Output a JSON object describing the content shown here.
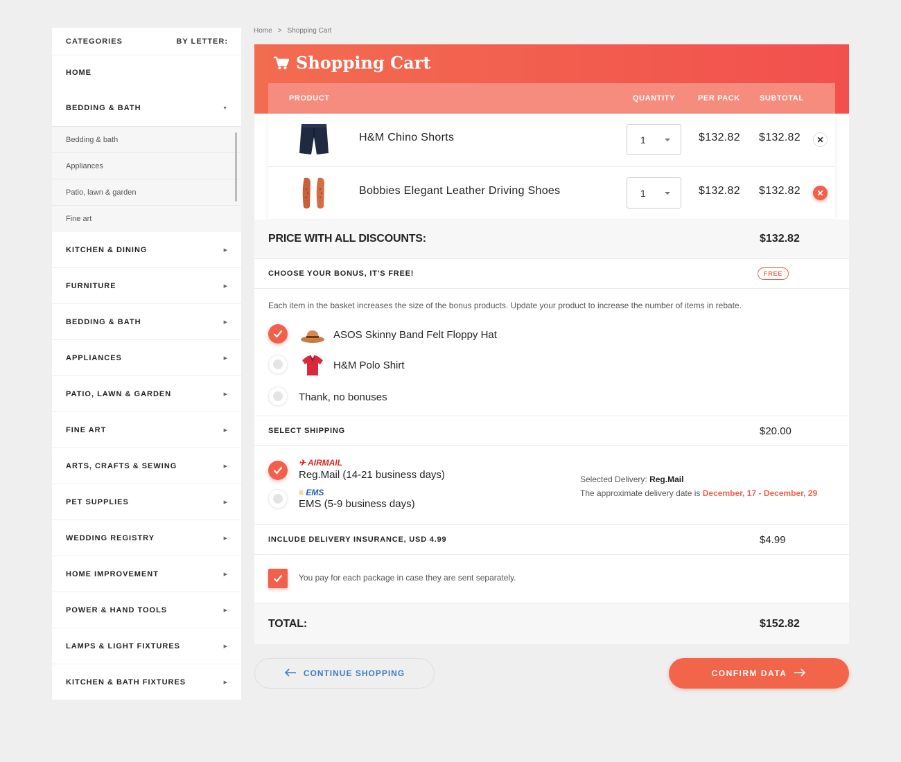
{
  "sidebar": {
    "header_left": "CATEGORIES",
    "header_right": "BY LETTER:",
    "home": "HOME",
    "open_category": "BEDDING & BATH",
    "subitems": [
      "Bedding & bath",
      "Appliances",
      "Patio, lawn & garden",
      "Fine art"
    ],
    "categories": [
      "KITCHEN & DINING",
      "FURNITURE",
      "BEDDING & BATH",
      "APPLIANCES",
      "PATIO, LAWN & GARDEN",
      "FINE ART",
      "ARTS, CRAFTS & SEWING",
      "PET SUPPLIES",
      "WEDDING REGISTRY",
      "HOME IMPROVEMENT",
      "POWER & HAND TOOLS",
      "LAMPS & LIGHT FIXTURES",
      "KITCHEN & BATH FIXTURES"
    ]
  },
  "breadcrumb": {
    "home": "Home",
    "sep": ">",
    "current": "Shopping Cart"
  },
  "cart": {
    "title": "Shopping Cart",
    "columns": {
      "product": "PRODUCT",
      "quantity": "QUANTITY",
      "per_pack": "PER PACK",
      "subtotal": "SUBTOTAL"
    },
    "items": [
      {
        "name": "H&M Chino Shorts",
        "qty": "1",
        "per_pack": "$132.82",
        "subtotal": "$132.82",
        "remove": "✕"
      },
      {
        "name": "Bobbies Elegant Leather Driving Shoes",
        "qty": "1",
        "per_pack": "$132.82",
        "subtotal": "$132.82",
        "remove": "✕"
      }
    ],
    "discount_label": "PRICE WITH ALL DISCOUNTS:",
    "discount_value": "$132.82"
  },
  "bonus": {
    "label": "CHOOSE YOUR BONUS, IT'S FREE!",
    "badge": "FREE",
    "note": "Each item in the basket increases the size of the bonus products. Update your product to increase the number of items in rebate.",
    "options": [
      "ASOS Skinny Band Felt Floppy Hat",
      "H&M Polo Shirt",
      "Thank, no bonuses"
    ]
  },
  "shipping": {
    "label": "SELECT SHIPPING",
    "value": "$20.00",
    "options": [
      {
        "carrier": "AIRMAIL",
        "desc": "Reg.Mail (14-21 business days)"
      },
      {
        "carrier": "EMS",
        "desc": "EMS (5-9 business days)"
      }
    ],
    "selected_label": "Selected Delivery:",
    "selected_value": "Reg.Mail",
    "approx_label": "The approximate delivery date is",
    "dates": "December, 17 - December, 29"
  },
  "insurance": {
    "label": "INCLUDE DELIVERY INSURANCE, USD 4.99",
    "value": "$4.99",
    "note": "You pay for each package in case they are sent separately."
  },
  "total": {
    "label": "TOTAL:",
    "value": "$152.82"
  },
  "buttons": {
    "continue": "CONTINUE SHOPPING",
    "confirm": "CONFIRM DATA"
  },
  "colors": {
    "accent": "#f2604b",
    "link": "#3b7dc4",
    "header_light": "#f58c7e"
  }
}
